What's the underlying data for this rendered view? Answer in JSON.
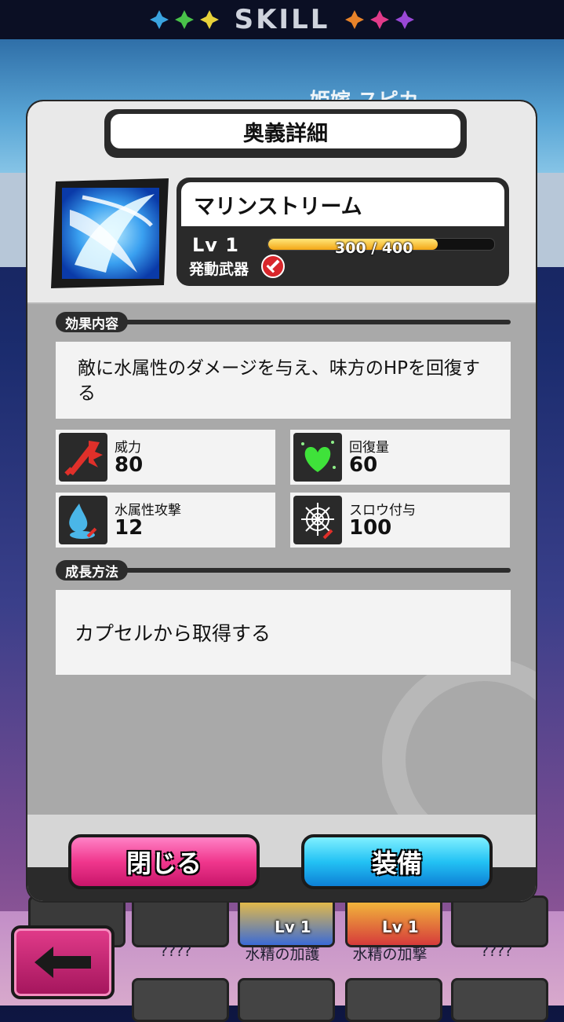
{
  "header": {
    "title": "SKILL"
  },
  "background": {
    "character_name": "姫嫁 スピカ",
    "cards": [
      {
        "label": "????",
        "level": ""
      },
      {
        "label": "水精の加護",
        "level": "Lv 1"
      },
      {
        "label": "水精の加撃",
        "level": "Lv 1"
      },
      {
        "label": "????",
        "level": ""
      }
    ]
  },
  "modal": {
    "title": "奥義詳細",
    "skill": {
      "name": "マリンストリーム",
      "level_label": "Lv 1",
      "exp_text": "300 / 400",
      "exp_current": 300,
      "exp_max": 400,
      "weapon_label": "発動武器"
    },
    "effect_section": {
      "label": "効果内容",
      "description": "敵に水属性のダメージを与え、味方のHPを回復する"
    },
    "stats": [
      {
        "label": "威力",
        "value": "80",
        "icon": "power-icon"
      },
      {
        "label": "回復量",
        "value": "60",
        "icon": "heart-heal-icon"
      },
      {
        "label": "水属性攻撃",
        "value": "12",
        "icon": "water-drop-icon"
      },
      {
        "label": "スロウ付与",
        "value": "100",
        "icon": "web-icon"
      }
    ],
    "growth_section": {
      "label": "成長方法",
      "text": "カプセルから取得する"
    },
    "buttons": {
      "close": "閉じる",
      "equip": "装備"
    }
  },
  "colors": {
    "close_button": "#f0378d",
    "equip_button": "#23c2f4",
    "exp_bar": "#f3a615"
  }
}
